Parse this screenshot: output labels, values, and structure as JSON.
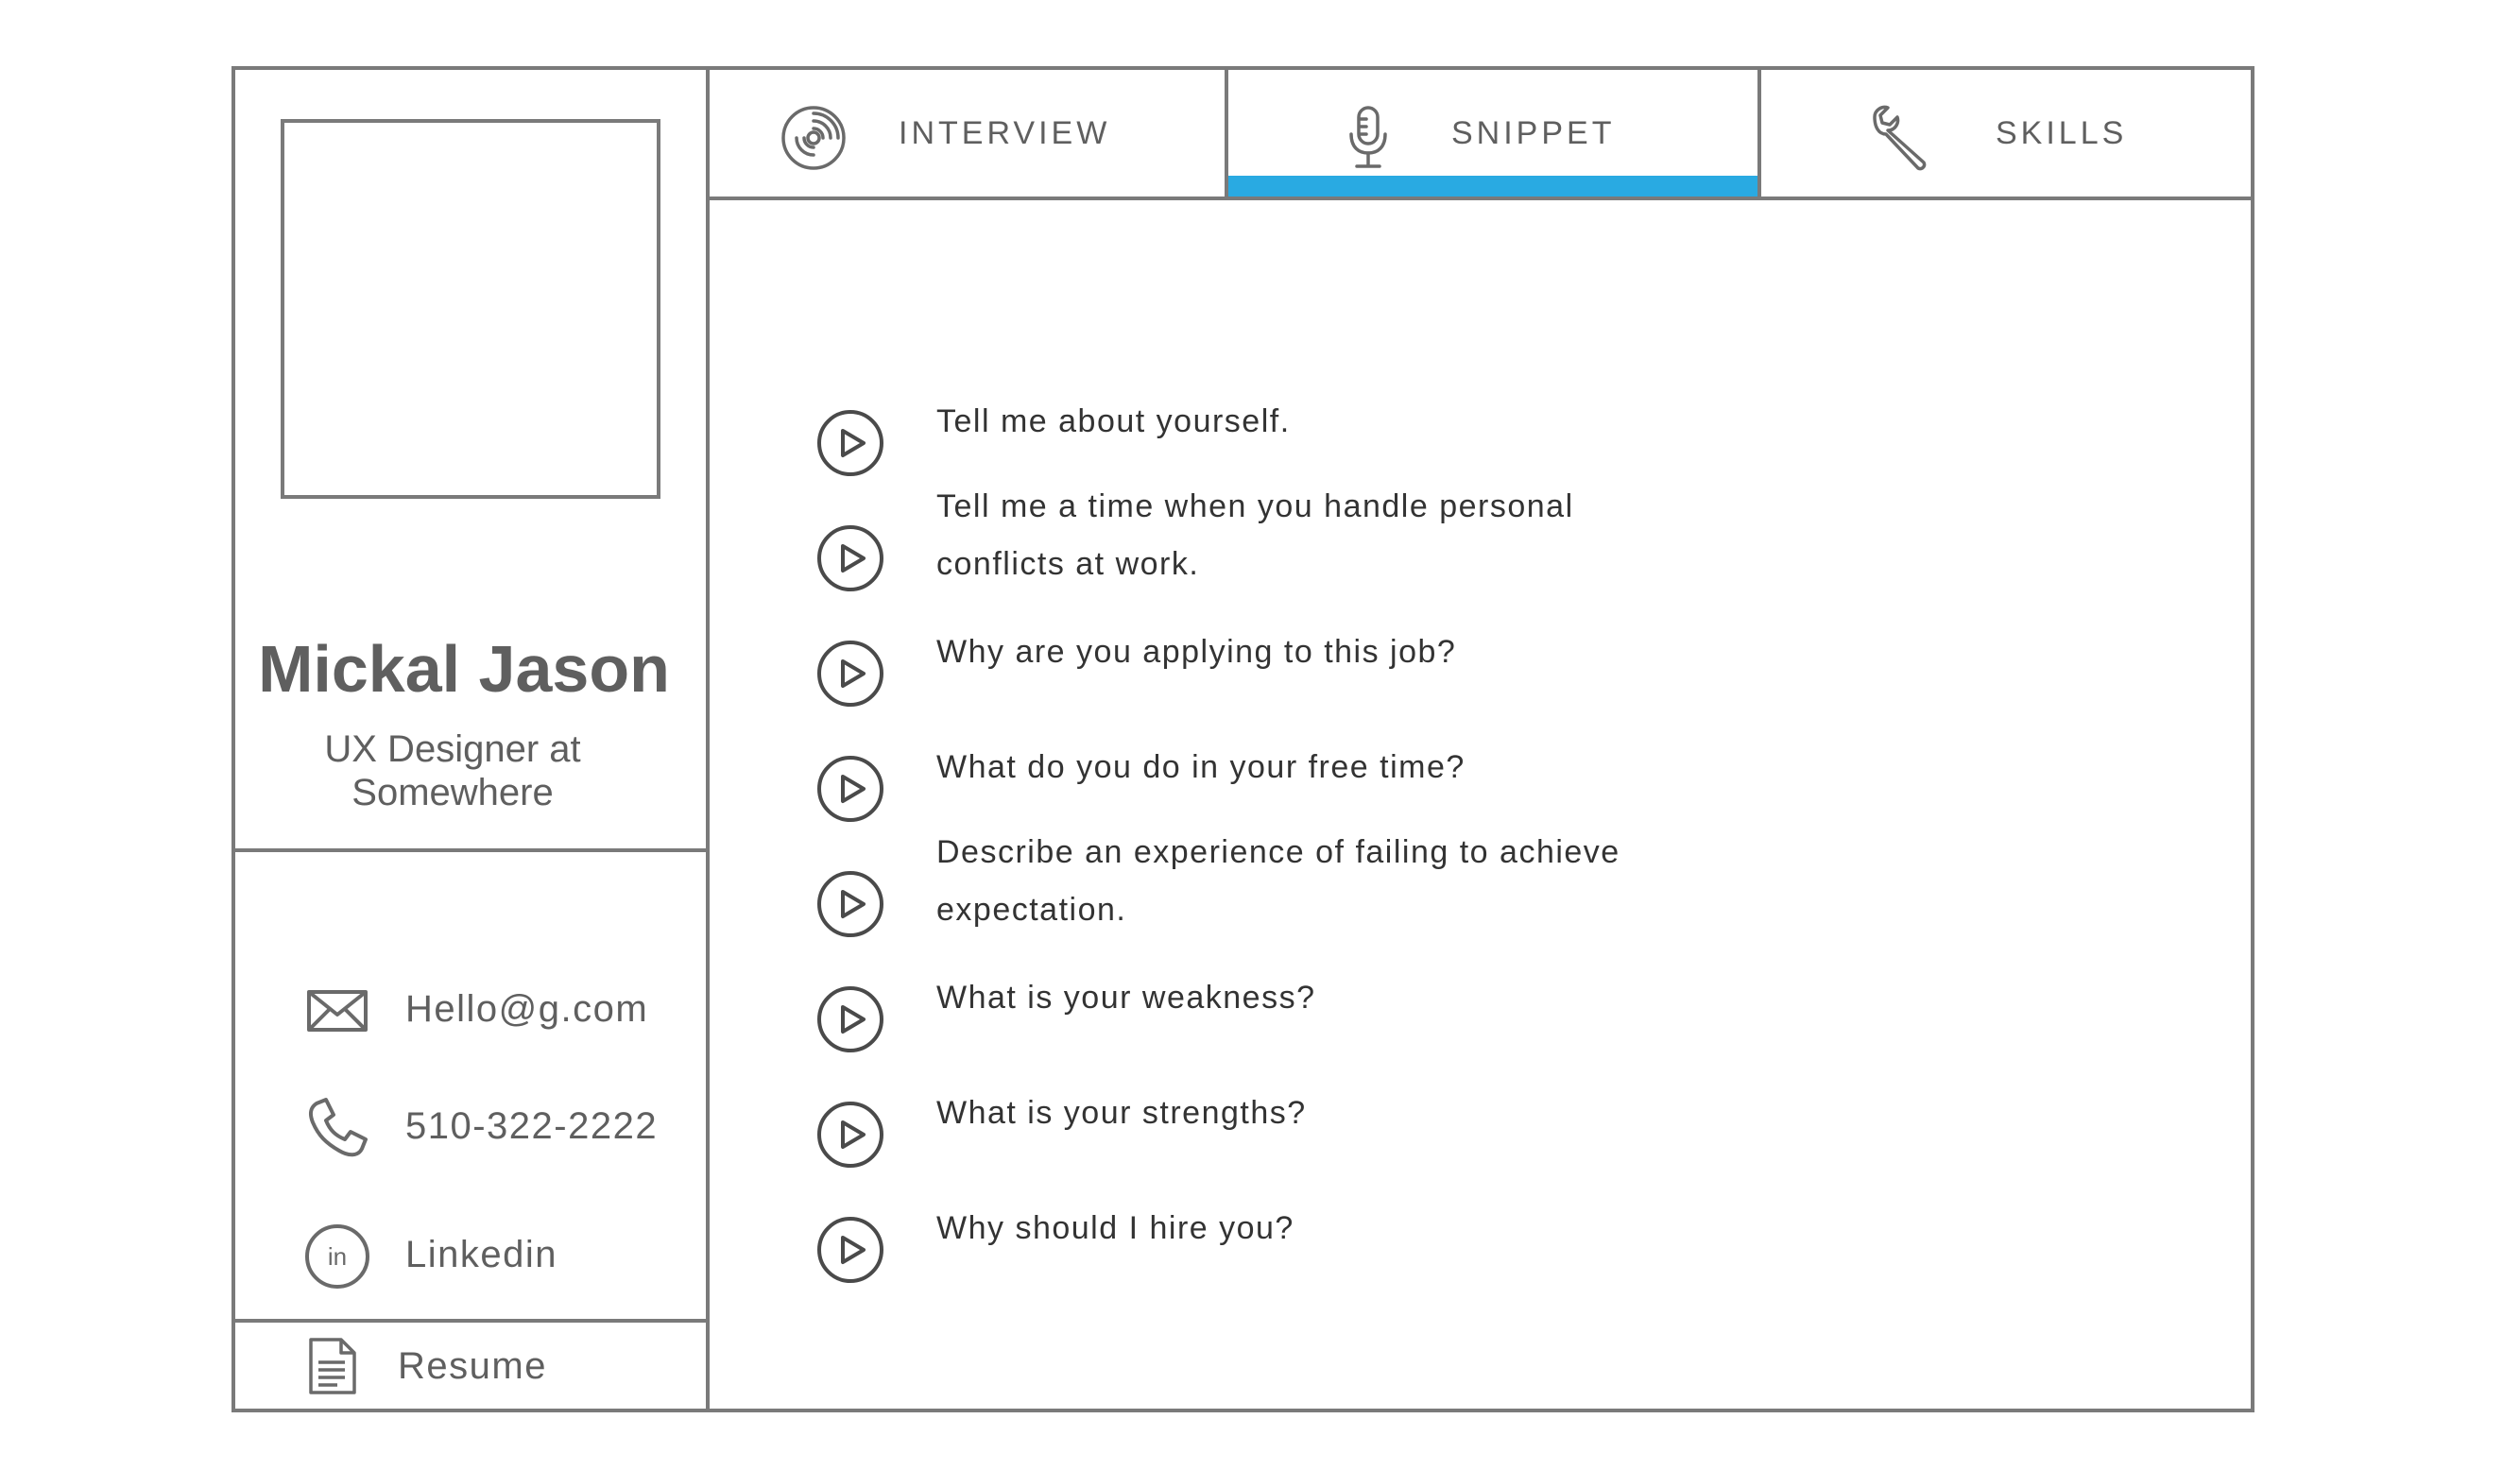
{
  "profile": {
    "name": "Mickal Jason",
    "role": "UX Designer at Somewhere"
  },
  "contacts": {
    "email": {
      "icon": "envelope-icon",
      "text": "Hello@g.com"
    },
    "phone": {
      "icon": "phone-icon",
      "text": "510-322-2222"
    },
    "linkedin": {
      "icon": "linkedin-icon",
      "text": "Linkedin"
    }
  },
  "resume": {
    "icon": "document-icon",
    "label": "Resume"
  },
  "tabs": [
    {
      "icon": "vinyl-record-icon",
      "label": "INTERVIEW",
      "active": false
    },
    {
      "icon": "microphone-icon",
      "label": "SNIPPET",
      "active": true
    },
    {
      "icon": "wrench-icon",
      "label": "SKILLS",
      "active": false
    }
  ],
  "colors": {
    "accent": "#29aae2",
    "border": "#7a7a7a",
    "text": "#5f5f5f",
    "question_text": "#333333"
  },
  "questions": [
    {
      "icon": "play-icon",
      "text": "Tell me about yourself."
    },
    {
      "icon": "play-icon",
      "text": "Tell me a time when you handle personal conflicts at work."
    },
    {
      "icon": "play-icon",
      "text": "Why are you applying to this job?"
    },
    {
      "icon": "play-icon",
      "text": "What do you do in your free time?"
    },
    {
      "icon": "play-icon",
      "text": "Describe an experience of failing to achieve expectation."
    },
    {
      "icon": "play-icon",
      "text": "What is your weakness?"
    },
    {
      "icon": "play-icon",
      "text": "What is your strengths?"
    },
    {
      "icon": "play-icon",
      "text": "Why should I hire you?"
    }
  ]
}
